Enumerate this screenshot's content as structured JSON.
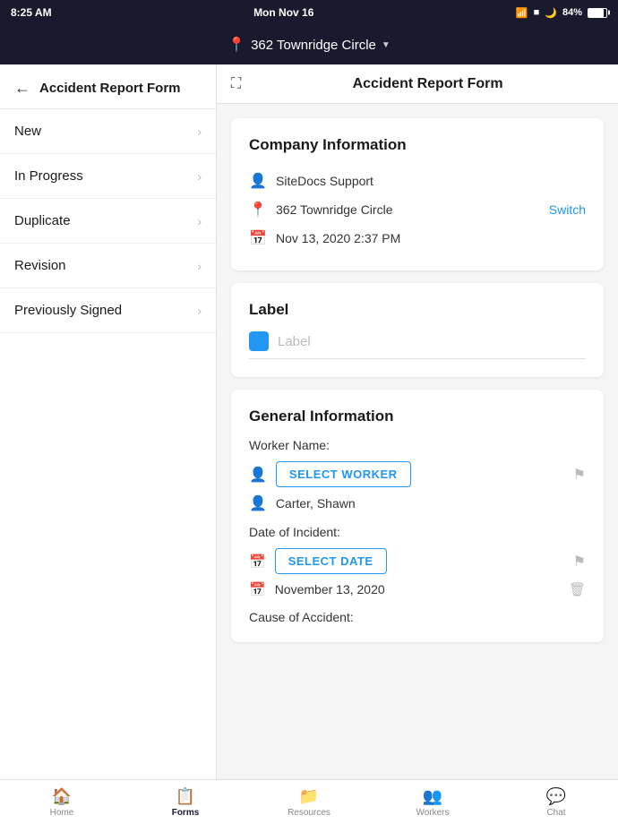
{
  "statusBar": {
    "time": "8:25 AM",
    "date": "Mon Nov 16",
    "battery": "84%"
  },
  "topNav": {
    "location": "362 Townridge Circle"
  },
  "sidebar": {
    "title": "Accident Report Form",
    "items": [
      {
        "id": "new",
        "label": "New"
      },
      {
        "id": "in-progress",
        "label": "In Progress"
      },
      {
        "id": "duplicate",
        "label": "Duplicate"
      },
      {
        "id": "revision",
        "label": "Revision"
      },
      {
        "id": "previously-signed",
        "label": "Previously Signed"
      }
    ]
  },
  "content": {
    "header": "Accident Report Form",
    "companyInfo": {
      "sectionTitle": "Company Information",
      "company": "SiteDocs Support",
      "location": "362 Townridge Circle",
      "datetime": "Nov 13, 2020 2:37 PM",
      "switchLabel": "Switch"
    },
    "labelSection": {
      "sectionTitle": "Label",
      "placeholder": "Label"
    },
    "generalInfo": {
      "sectionTitle": "General Information",
      "workerNameLabel": "Worker Name:",
      "selectWorkerBtn": "SELECT WORKER",
      "workerName": "Carter, Shawn",
      "dateOfIncidentLabel": "Date of Incident:",
      "selectDateBtn": "SELECT DATE",
      "dateValue": "November 13, 2020",
      "causeLabel": "Cause of Accident:"
    }
  },
  "tabs": [
    {
      "id": "home",
      "label": "Home",
      "icon": "🏠",
      "active": false
    },
    {
      "id": "forms",
      "label": "Forms",
      "icon": "📋",
      "active": true
    },
    {
      "id": "resources",
      "label": "Resources",
      "icon": "📁",
      "active": false
    },
    {
      "id": "workers",
      "label": "Workers",
      "icon": "👥",
      "active": false
    },
    {
      "id": "chat",
      "label": "Chat",
      "icon": "💬",
      "active": false
    }
  ]
}
